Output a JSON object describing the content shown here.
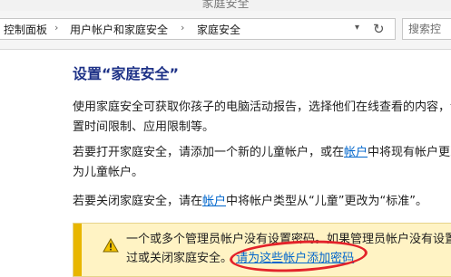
{
  "window": {
    "title": "家庭安全"
  },
  "breadcrumb": {
    "items": [
      "控制面板",
      "用户帐户和家庭安全",
      "家庭安全"
    ],
    "separator": "›"
  },
  "search": {
    "placeholder": "搜索控"
  },
  "main": {
    "heading": "设置“家庭安全”",
    "para1": "使用家庭安全可获取你孩子的电脑活动报告，选择他们在线查看的内容，设置时间限制、应用限制等。",
    "para2_before": "若要打开家庭安全，请添加一个新的儿童帐户，或在",
    "para2_link": "帐户",
    "para2_after": "中将现有帐户更改为儿童帐户。",
    "para3_before": "若要关闭家庭安全，请在",
    "para3_link": "帐户",
    "para3_after": "中将帐户类型从“儿童”更改为“标准”。"
  },
  "warning": {
    "line1": "一个或多个管理员帐户没有设置密码。如果管理员帐户没有设置",
    "line2_before": "过或关闭家庭安全。",
    "line2_link": "请为这些帐户添加密码"
  },
  "colors": {
    "heading": "#1e3287",
    "link": "#0066cc",
    "warning_bg": "#fff3c4",
    "warning_bar": "#e8b600",
    "annotation": "#e3232a"
  }
}
